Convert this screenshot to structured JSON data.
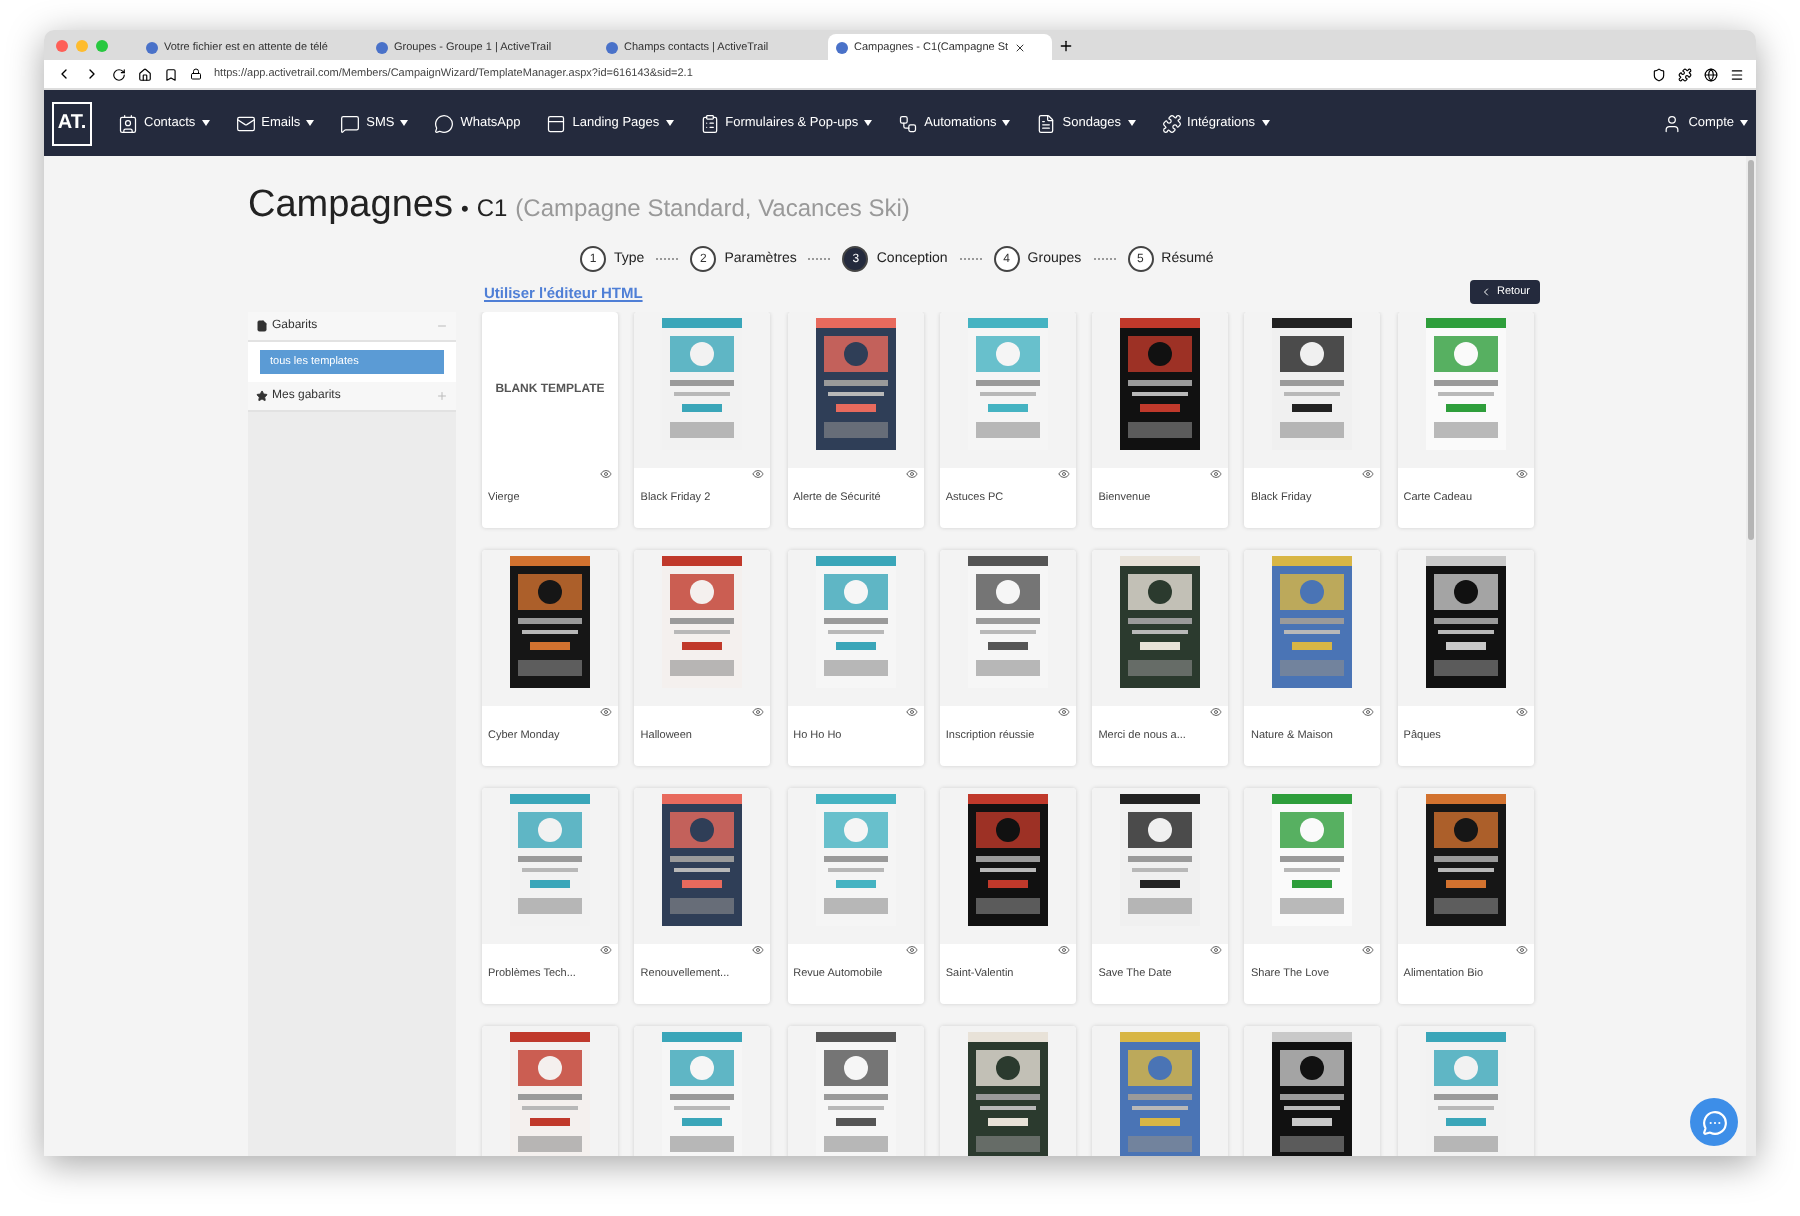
{
  "browser": {
    "tabs": [
      {
        "title": "Votre fichier est en attente de télé",
        "selected": false
      },
      {
        "title": "Groupes - Groupe 1 | ActiveTrail",
        "selected": false
      },
      {
        "title": "Champs contacts | ActiveTrail",
        "selected": false
      },
      {
        "title": "Campagnes - C1(Campagne St",
        "selected": true
      }
    ],
    "url": "https://app.activetrail.com/Members/CampaignWizard/TemplateManager.aspx?id=616143&sid=2.1"
  },
  "nav": {
    "logo": "AT.",
    "items": [
      {
        "label": "Contacts",
        "dropdown": true
      },
      {
        "label": "Emails",
        "dropdown": true
      },
      {
        "label": "SMS",
        "dropdown": true
      },
      {
        "label": "WhatsApp",
        "dropdown": false
      },
      {
        "label": "Landing Pages",
        "dropdown": true
      },
      {
        "label": "Formulaires & Pop-ups",
        "dropdown": true
      },
      {
        "label": "Automations",
        "dropdown": true
      },
      {
        "label": "Sondages",
        "dropdown": true
      },
      {
        "label": "Intégrations",
        "dropdown": true
      }
    ],
    "account": {
      "label": "Compte",
      "dropdown": true
    }
  },
  "page": {
    "title": "Campagnes",
    "separator": "•",
    "code": "C1",
    "detail": "(Campagne Standard, Vacances Ski)"
  },
  "steps": [
    {
      "number": "1",
      "label": "Type",
      "selected": false
    },
    {
      "number": "2",
      "label": "Paramètres",
      "selected": false
    },
    {
      "number": "3",
      "label": "Conception",
      "selected": true
    },
    {
      "number": "4",
      "label": "Groupes",
      "selected": false
    },
    {
      "number": "5",
      "label": "Résumé",
      "selected": false
    }
  ],
  "html_link": "Utiliser l'éditeur HTML",
  "back_button": "Retour",
  "sidebar": [
    {
      "title": "Gabarits",
      "expanded": true,
      "items": [
        {
          "label": "tous les templates",
          "selected": true
        }
      ]
    },
    {
      "title": "Mes gabarits",
      "expanded": false
    }
  ],
  "templates": [
    {
      "name": "Vierge",
      "blank_text": "BLANK TEMPLATE"
    },
    {
      "name": "Black Friday 2"
    },
    {
      "name": "Alerte de Sécurité"
    },
    {
      "name": "Astuces PC"
    },
    {
      "name": "Bienvenue"
    },
    {
      "name": "Black Friday"
    },
    {
      "name": "Carte Cadeau"
    },
    {
      "name": "Cyber Monday"
    },
    {
      "name": "Halloween"
    },
    {
      "name": "Ho Ho Ho"
    },
    {
      "name": "Inscription réussie"
    },
    {
      "name": "Merci de nous a..."
    },
    {
      "name": "Nature & Maison"
    },
    {
      "name": "Pâques"
    },
    {
      "name": "Problèmes Tech..."
    },
    {
      "name": "Renouvellement..."
    },
    {
      "name": "Revue Automobile"
    },
    {
      "name": "Saint-Valentin"
    },
    {
      "name": "Save The Date"
    },
    {
      "name": "Share The Love"
    },
    {
      "name": "Alimentation Bio"
    },
    {
      "kind": "picture"
    },
    {
      "kind": "picture"
    },
    {
      "kind": "picture"
    },
    {
      "kind": "picture"
    },
    {
      "kind": "picture"
    },
    {
      "kind": "picture"
    },
    {
      "kind": "picture"
    }
  ]
}
